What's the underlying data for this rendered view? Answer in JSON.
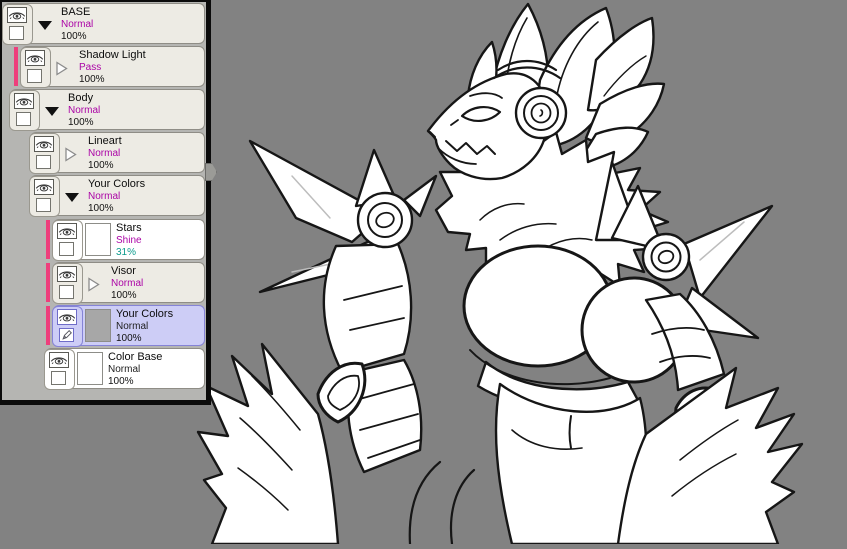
{
  "panel": {
    "kind": "layers-panel",
    "layers": [
      {
        "name": "BASE",
        "mode": "Normal",
        "opacity": "100%",
        "type": "folder",
        "expanded": true,
        "clipped": false,
        "selected": false
      },
      {
        "name": "Shadow Light",
        "mode": "Pass",
        "opacity": "100%",
        "type": "folder",
        "expanded": false,
        "clipped": true,
        "selected": false
      },
      {
        "name": "Body",
        "mode": "Normal",
        "opacity": "100%",
        "type": "folder",
        "expanded": true,
        "clipped": false,
        "selected": false
      },
      {
        "name": "Lineart",
        "mode": "Normal",
        "opacity": "100%",
        "type": "folder",
        "expanded": false,
        "clipped": false,
        "selected": false
      },
      {
        "name": "Your Colors",
        "mode": "Normal",
        "opacity": "100%",
        "type": "folder",
        "expanded": true,
        "clipped": false,
        "selected": false
      },
      {
        "name": "Stars",
        "mode": "Shine",
        "opacity": "31%",
        "type": "layer",
        "clipped": true,
        "selected": false,
        "thumbnail": "white"
      },
      {
        "name": "Visor",
        "mode": "Normal",
        "opacity": "100%",
        "type": "folder",
        "expanded": false,
        "clipped": true,
        "selected": false
      },
      {
        "name": "Your Colors",
        "mode": "Normal",
        "opacity": "100%",
        "type": "layer",
        "clipped": true,
        "selected": true,
        "thumbnail": "gray",
        "editing": true
      },
      {
        "name": "Color Base",
        "mode": "Normal",
        "opacity": "100%",
        "type": "layer",
        "clipped": false,
        "selected": false,
        "thumbnail": "white"
      }
    ]
  },
  "canvas": {
    "background_color": "#828282",
    "line_color": "#161616",
    "fill_color": "#ffffff",
    "content": "lineart of anthropomorphic fox character with headphones, spiked shoulder armor and fluffy fur"
  },
  "colors": {
    "clip_indicator_pink": "#ee3e7c",
    "mode_text_magenta": "#ab04a6",
    "opacity_text_teal": "#0c9b8d",
    "selected_layer_bg": "#cdcdf6",
    "selected_layer_border": "#8583d6",
    "folder_item_bg": "#edebe4",
    "layer_item_bg": "#ffffff",
    "panel_bg": "#b5b5b2",
    "panel_border": "#0b0b0b"
  }
}
